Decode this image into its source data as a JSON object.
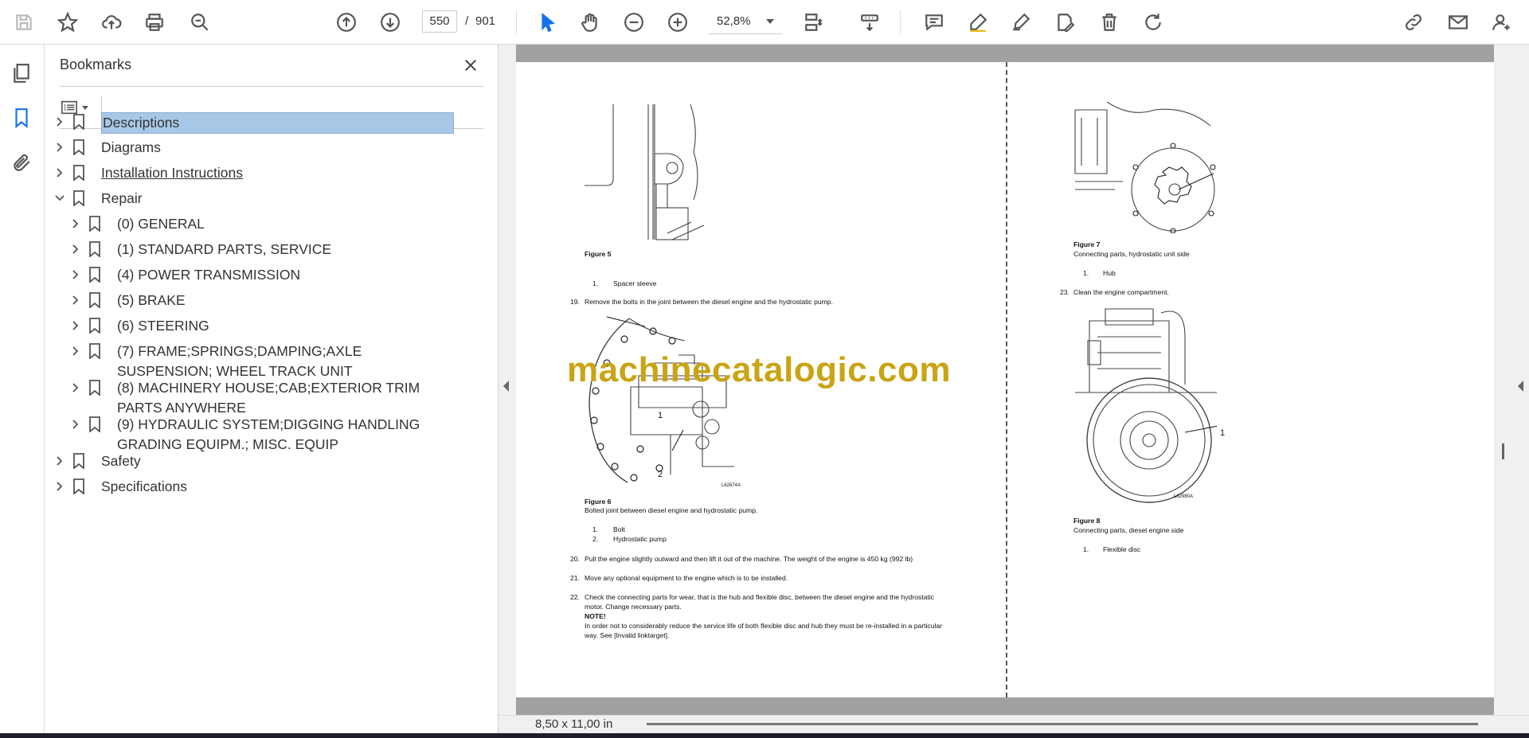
{
  "toolbar": {
    "page_current": "550",
    "page_separator": "/",
    "page_total": "901",
    "zoom": "52,8%"
  },
  "bookmarks_panel": {
    "title": "Bookmarks",
    "items": [
      {
        "label": "Descriptions",
        "level": 0,
        "expanded": false,
        "selected": true
      },
      {
        "label": "Diagrams",
        "level": 0,
        "expanded": false
      },
      {
        "label": "Installation Instructions",
        "level": 0,
        "expanded": false,
        "underline": true
      },
      {
        "label": "Repair",
        "level": 0,
        "expanded": true
      },
      {
        "label": "(0) GENERAL",
        "level": 1
      },
      {
        "label": "(1) STANDARD PARTS, SERVICE",
        "level": 1
      },
      {
        "label": "(4) POWER TRANSMISSION",
        "level": 1
      },
      {
        "label": "(5) BRAKE",
        "level": 1
      },
      {
        "label": "(6) STEERING",
        "level": 1
      },
      {
        "label": "(7) FRAME;SPRINGS;DAMPING;AXLE SUSPENSION; WHEEL TRACK UNIT",
        "level": 1
      },
      {
        "label": "(8) MACHINERY HOUSE;CAB;EXTERIOR TRIM PARTS ANYWHERE",
        "level": 1
      },
      {
        "label": "(9) HYDRAULIC SYSTEM;DIGGING HANDLING GRADING EQUIPM.; MISC. EQUIP",
        "level": 1
      },
      {
        "label": "Safety",
        "level": 0,
        "expanded": false
      },
      {
        "label": "Specifications",
        "level": 0,
        "expanded": false
      }
    ]
  },
  "status": {
    "page_size": "8,50 x 11,00 in"
  },
  "watermark": "machinecatalogic.com",
  "document": {
    "left": {
      "fig5_caption": "Figure 5",
      "fig5_item1_num": "1.",
      "fig5_item1": "Spacer sleeve",
      "step19_num": "19.",
      "step19": "Remove the bolts in the joint between the diesel engine and the hydrostatic pump.",
      "fig6_callout1": "1",
      "fig6_callout2": "2",
      "fig6_code": "L62674A",
      "fig6_caption": "Figure 6",
      "fig6_desc": "Bolted joint between diesel engine and hydrostatic pump.",
      "fig6_item1_num": "1.",
      "fig6_item1": "Bolt",
      "fig6_item2_num": "2.",
      "fig6_item2": "Hydrostatic pump",
      "step20_num": "20.",
      "step20": "Pull the engine slightly outward and then lift it out of the machine. The weight of the engine is 450 kg (992 lb)",
      "step21_num": "21.",
      "step21": "Move any optional equipment to the engine which is to be installed.",
      "step22_num": "22.",
      "step22_line1": "Check the connecting parts for wear, that is the hub and flexible disc, between the diesel engine and the hydrostatic",
      "step22_line2": "motor. Change necessary parts.",
      "note_label": "NOTE!",
      "note_line1": "In order not to considerably reduce the service life of both flexible disc and hub they must be re-installed in a particular",
      "note_line2": "way. See [Invalid linktarget]."
    },
    "right": {
      "fig7_caption": "Figure 7",
      "fig7_desc": "Connecting parts, hydrostatic unit side",
      "fig7_item1_num": "1.",
      "fig7_item1": "Hub",
      "step23_num": "23.",
      "step23": "Clean the engine compartment.",
      "fig8_callout1": "1",
      "fig8_code": "L62980A",
      "fig8_caption": "Figure 8",
      "fig8_desc": "Connecting parts, diesel engine side",
      "fig8_item1_num": "1.",
      "fig8_item1": "Flexible disc"
    }
  },
  "colors": {
    "selection": "#a6c8e6",
    "watermark": "#c9a414",
    "page_bar": "#a0a0a0"
  }
}
